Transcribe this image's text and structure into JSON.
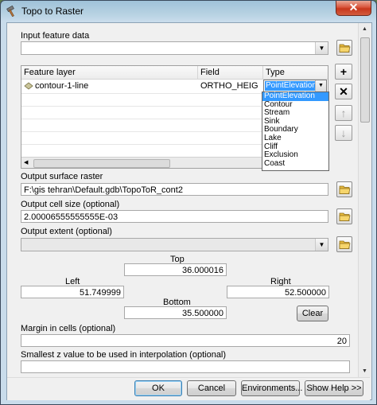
{
  "window": {
    "title": "Topo to Raster",
    "close_label": "✕"
  },
  "input_feature_data": {
    "label": "Input feature data",
    "value": ""
  },
  "grid": {
    "columns": [
      "Feature layer",
      "Field",
      "Type"
    ],
    "rows": [
      {
        "feature_layer": "contour-1-line",
        "field": "ORTHO_HEIG",
        "type": "PointElevation"
      }
    ]
  },
  "type_dropdown": {
    "options": [
      "PointElevation",
      "Contour",
      "Stream",
      "Sink",
      "Boundary",
      "Lake",
      "Cliff",
      "Exclusion",
      "Coast"
    ],
    "selected": "PointElevation"
  },
  "side_buttons": {
    "add": "+",
    "remove": "✕",
    "up": "↑",
    "down": "↓"
  },
  "output_surface_raster": {
    "label": "Output surface raster",
    "value": "F:\\gis tehran\\Default.gdb\\TopoToR_cont2"
  },
  "output_cell_size": {
    "label": "Output cell size (optional)",
    "value": "2.00006555555555E-03"
  },
  "output_extent": {
    "label": "Output extent (optional)",
    "value": "",
    "top_label": "Top",
    "top": "36.000016",
    "left_label": "Left",
    "left": "51.749999",
    "right_label": "Right",
    "right": "52.500000",
    "bottom_label": "Bottom",
    "bottom": "35.500000",
    "clear_label": "Clear"
  },
  "margin_in_cells": {
    "label": "Margin in cells (optional)",
    "value": "20"
  },
  "smallest_z": {
    "label": "Smallest z value to be used in interpolation (optional)",
    "value": ""
  },
  "buttons": {
    "ok": "OK",
    "cancel": "Cancel",
    "environments": "Environments...",
    "show_help": "Show Help >>"
  }
}
